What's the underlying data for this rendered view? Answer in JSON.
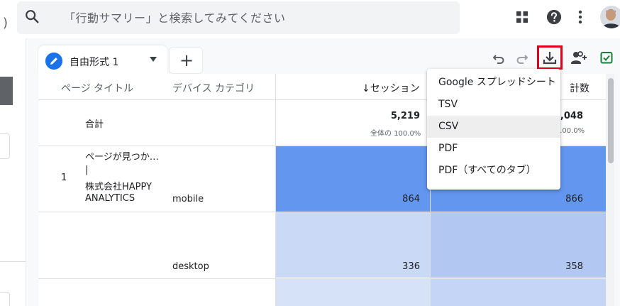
{
  "topbar": {
    "left_fragment": ")",
    "search_placeholder": "「行動サマリー」と検索してみてください",
    "icons": [
      "search-icon",
      "apps-grid-icon",
      "help-icon",
      "more-vert-icon",
      "avatar"
    ]
  },
  "tabs": [
    {
      "label": "自由形式 1",
      "active": true
    }
  ],
  "add_tab_label": "+",
  "toolbar": {
    "icons": [
      "undo-icon",
      "redo-icon",
      "download-icon",
      "share-icon",
      "insights-icon"
    ],
    "highlight_color": "#e0001b"
  },
  "table": {
    "headers": {
      "page_title": "ページ タイトル",
      "device_category": "デバイス カテゴリ",
      "sessions": "↓セッション",
      "views_partial": "計数"
    },
    "totals": {
      "label": "合計",
      "sessions": "5,219",
      "sessions_pct": "全体の 100.0%",
      "views": ",048",
      "views_pct": "100.0%"
    },
    "rows": [
      {
        "index": "1",
        "title_lines": [
          "ページが見つか…",
          "|",
          "株式会社HAPPY",
          "ANALYTICS"
        ],
        "device": "mobile",
        "sessions": "864",
        "views": "866"
      },
      {
        "index": "",
        "title_lines": [],
        "device": "desktop",
        "sessions": "336",
        "views": "358"
      }
    ],
    "colors": {
      "heat_high": "#6296ef",
      "heat_mid_sessions": "#c9d9f6",
      "heat_mid_views": "#b2c8f3"
    }
  },
  "menu": {
    "items": [
      {
        "label": "Google スプレッドシート",
        "hover": false
      },
      {
        "label": "TSV",
        "hover": false
      },
      {
        "label": "CSV",
        "hover": true
      },
      {
        "label": "PDF",
        "hover": false
      },
      {
        "label": "PDF（すべてのタブ）",
        "hover": false
      }
    ]
  }
}
